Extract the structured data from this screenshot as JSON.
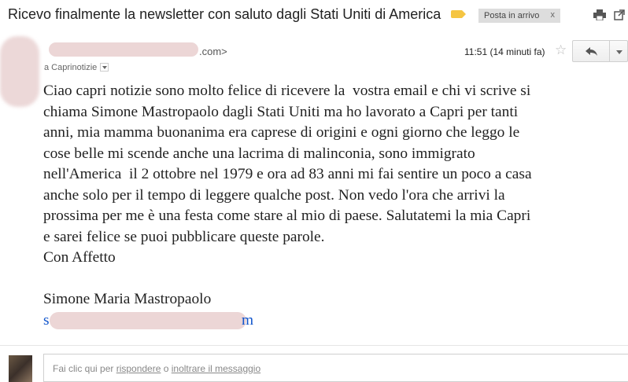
{
  "subject": {
    "title": "Ricevo finalmente la newsletter con saluto dagli Stati Uniti di America",
    "label": "Posta in arrivo",
    "label_remove": "x"
  },
  "message": {
    "sender_email_visible": ".com>",
    "recipient": "a Caprinotizie",
    "time": "11:51 (14 minuti fa)",
    "body_lines": [
      "Ciao capri notizie sono molto felice di ricevere la  vostra email e chi vi scrive si",
      "chiama Simone Mastropaolo dagli Stati Uniti ma ho lavorato a Capri per tanti",
      "anni, mia mamma buonanima era caprese di origini e ogni giorno che leggo le",
      "cose belle mi scende anche una lacrima di malinconia, sono immigrato",
      "nell'America  il 2 ottobre nel 1979 e ora ad 83 anni mi fai sentire un poco a casa",
      "anche solo per il tempo di leggere qualche post. Non vedo l'ora che arrivi la",
      "prossima per me è una festa come stare al mio di paese. Salutatemi la mia Capri",
      "e sarei felice se puoi pubblicare queste parole.",
      "Con Affetto"
    ],
    "signature_name": "Simone Maria Mastropaolo",
    "signature_email_start": "s",
    "signature_email_end": "m"
  },
  "reply_box": {
    "prefix": "Fai clic qui per ",
    "reply_link": "rispondere",
    "middle": " o ",
    "forward_link": "inoltrare il messaggio"
  },
  "icons": {
    "label": "label-tag-icon",
    "print": "print-icon",
    "new_window": "new-window-icon",
    "star": "star-icon",
    "reply": "reply-arrow-icon",
    "more": "chevron-down-icon"
  },
  "colors": {
    "label_tag": "#f5c542",
    "link": "#1155cc",
    "redaction": "#ecd6d6"
  }
}
